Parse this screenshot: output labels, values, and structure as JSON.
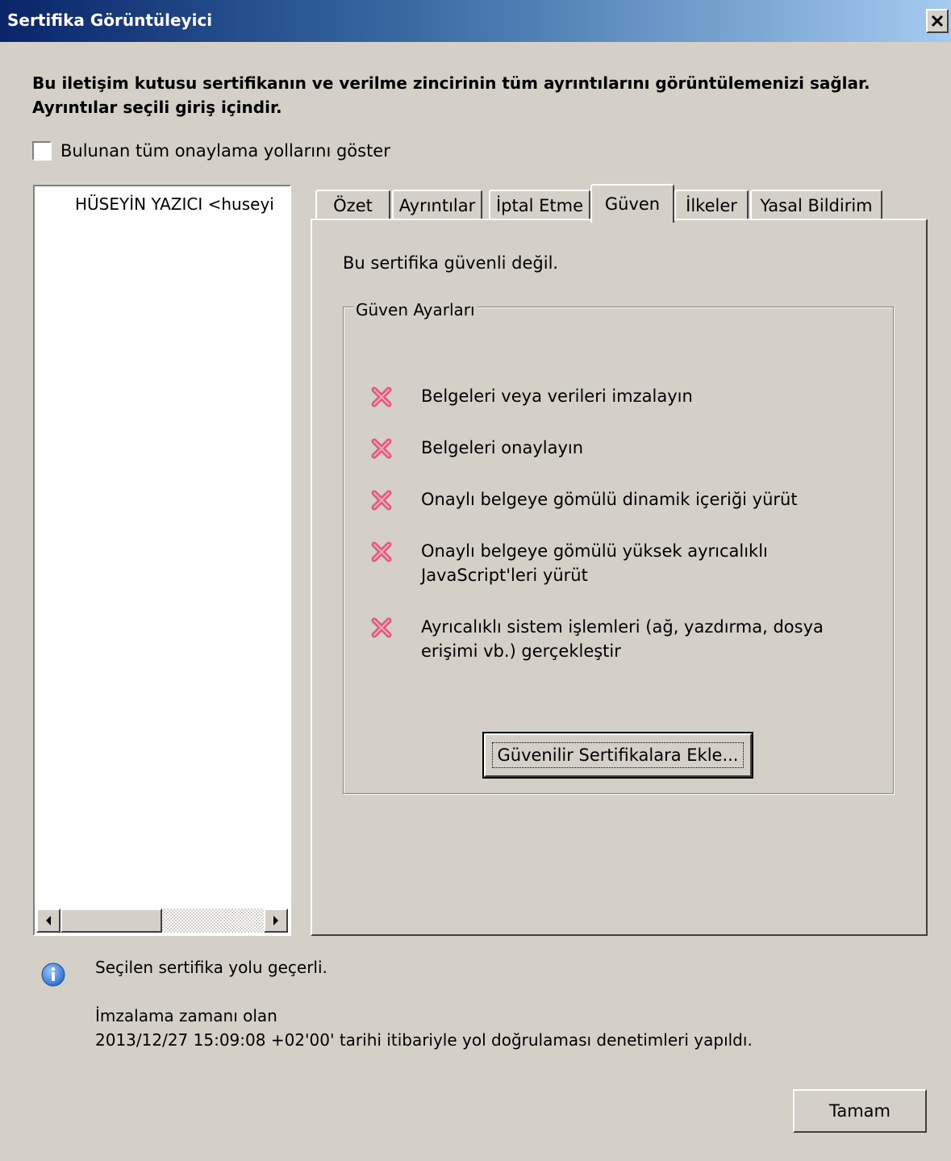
{
  "window": {
    "title": "Sertifika Görüntüleyici",
    "close_glyph": "×"
  },
  "intro": {
    "line1": "Bu iletişim kutusu sertifikanın ve verilme zincirinin tüm ayrıntılarını görüntülemenizi sağlar.",
    "line2": "Ayrıntılar seçili giriş içindir."
  },
  "show_all_paths": {
    "label": "Bulunan tüm onaylama yollarını göster",
    "checked": false
  },
  "tree": {
    "items": [
      "HÜSEYİN YAZICI <huseyi"
    ]
  },
  "tabs": [
    {
      "label": "Özet",
      "active": false
    },
    {
      "label": "Ayrıntılar",
      "active": false
    },
    {
      "label": "İptal Etme",
      "active": false
    },
    {
      "label": "Güven",
      "active": true
    },
    {
      "label": "İlkeler",
      "active": false
    },
    {
      "label": "Yasal Bildirim",
      "active": false
    }
  ],
  "trust": {
    "status": "Bu sertifika güvenli değil.",
    "group_title": "Güven Ayarları",
    "permissions": [
      {
        "label": "Belgeleri veya verileri imzalayın",
        "allowed": false
      },
      {
        "label": "Belgeleri onaylayın",
        "allowed": false
      },
      {
        "label": "Onaylı belgeye gömülü dinamik içeriği yürüt",
        "allowed": false
      },
      {
        "label": "Onaylı belgeye gömülü yüksek ayrıcalıklı JavaScript'leri yürüt",
        "allowed": false
      },
      {
        "label": "Ayrıcalıklı sistem işlemleri (ağ, yazdırma, dosya erişimi vb.) gerçekleştir",
        "allowed": false
      }
    ],
    "add_button_label": "Güvenilir Sertifikalara Ekle..."
  },
  "footer": {
    "validity": "Seçilen sertifika yolu geçerli.",
    "time_line1": "İmzalama zamanı olan",
    "time_line2": "2013/12/27 15:09:08 +02'00' tarihi itibariyle yol doğrulaması denetimleri yapıldı.",
    "ok_label": "Tamam"
  },
  "colors": {
    "dialog_bg": "#d4d0c8",
    "title_gradient_start": "#0a246a",
    "title_gradient_end": "#a6caf0",
    "deny_icon": "#e05a7a",
    "info_icon": "#2f6fd0"
  },
  "icons": {
    "deny": "red-x-icon",
    "info": "info-icon"
  }
}
